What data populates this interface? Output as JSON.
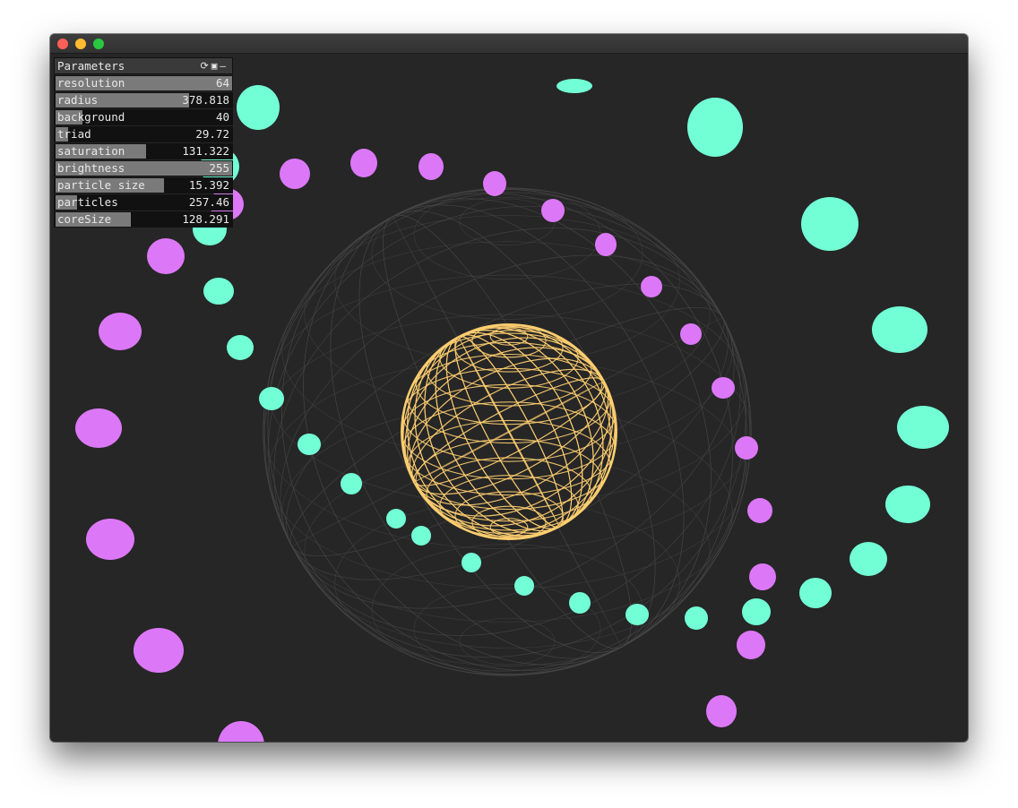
{
  "window": {
    "buttons": {
      "close": "close",
      "minimize": "minimize",
      "zoom": "zoom"
    }
  },
  "colors": {
    "background": "#262626",
    "core": "#ffcf70",
    "teal": "#72ffd6",
    "magenta": "#dc78f7",
    "wireframe": "#4a4a4a"
  },
  "panel": {
    "title": "Parameters",
    "icons": [
      "refresh-icon",
      "save-icon",
      "collapse-icon"
    ],
    "params": [
      {
        "label": "resolution",
        "value": "64",
        "fill": 1.0
      },
      {
        "label": "radius",
        "value": "378.818",
        "fill": 0.76
      },
      {
        "label": "background",
        "value": "40",
        "fill": 0.16
      },
      {
        "label": "triad",
        "value": "29.72",
        "fill": 0.08
      },
      {
        "label": "saturation",
        "value": "131.322",
        "fill": 0.52
      },
      {
        "label": "brightness",
        "value": "255",
        "fill": 1.0
      },
      {
        "label": "particle size",
        "value": "15.392",
        "fill": 0.62
      },
      {
        "label": "particles",
        "value": "257.46",
        "fill": 0.13
      },
      {
        "label": "coreSize",
        "value": "128.291",
        "fill": 0.43
      }
    ]
  }
}
